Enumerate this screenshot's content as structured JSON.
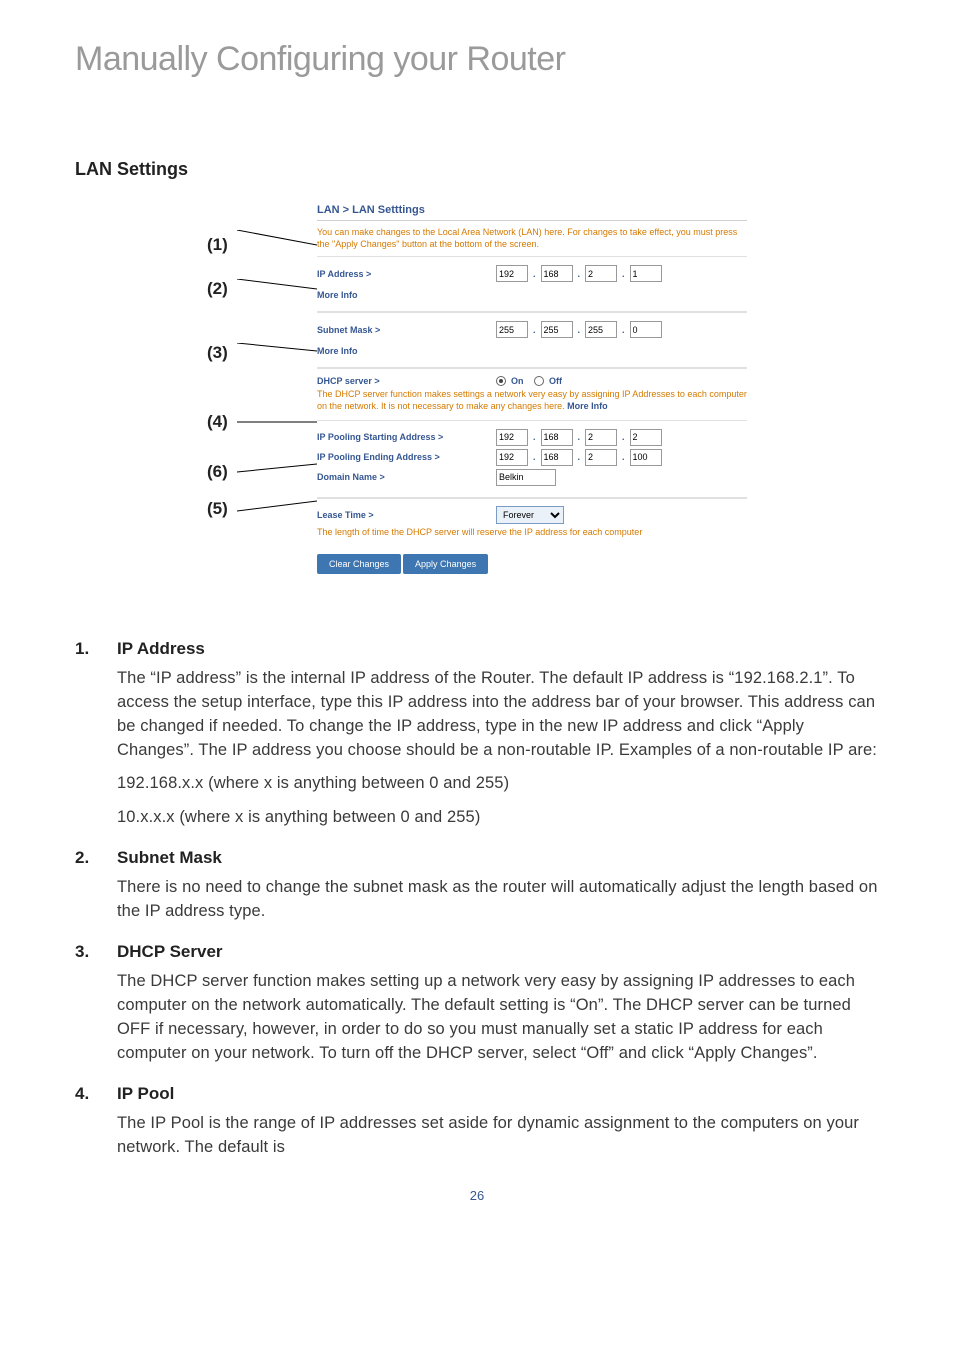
{
  "main_title": "Manually Configuring your Router",
  "lan": {
    "heading": "LAN Settings",
    "panel_header": "LAN > LAN Setttings",
    "panel_desc": "You can make changes to the Local Area Network (LAN) here. For changes to take effect, you must press the \"Apply Changes\" button at the bottom of the screen.",
    "ip_label": "IP Address >",
    "ip": [
      "192",
      "168",
      "2",
      "1"
    ],
    "more_info": "More Info",
    "sm_label": "Subnet Mask >",
    "sm": [
      "255",
      "255",
      "255",
      "0"
    ],
    "dhcp_label": "DHCP server >",
    "on": "On",
    "off": "Off",
    "dhcp_desc": "The DHCP server function makes settings a network very easy by assigning IP Addresses to each computer on the network. It is not necessary to make any changes here. ",
    "pool_start_label": "IP Pooling Starting Address >",
    "pool_start": [
      "192",
      "168",
      "2",
      "2"
    ],
    "pool_end_label": "IP Pooling Ending Address >",
    "pool_end": [
      "192",
      "168",
      "2",
      "100"
    ],
    "domain_label": "Domain Name >",
    "domain_val": "Belkin",
    "lease_label": "Lease Time >",
    "lease_val": "Forever",
    "lease_desc": "The length of time the DHCP server will reserve the IP address for each computer",
    "btn_clear": "Clear Changes",
    "btn_apply": "Apply Changes"
  },
  "callouts": [
    "(1)",
    "(2)",
    "(3)",
    "(4)",
    "(6)",
    "(5)"
  ],
  "items": [
    {
      "num": "1.",
      "title": "IP Address",
      "body": "The “IP address” is the internal IP address of the Router. The default IP address is “192.168.2.1”. To access the setup interface, type this IP address into the address bar of your browser. This address can be changed if needed. To change the IP address, type in the new IP address and click “Apply Changes”. The IP address you choose should be a non-routable IP. Examples of a non-routable IP are:",
      "examples": [
        "192.168.x.x (where x is anything between 0 and 255)",
        "10.x.x.x (where x is anything between 0 and 255)"
      ]
    },
    {
      "num": "2.",
      "title": "Subnet Mask",
      "body": "There is no need to change the subnet mask as the router will automatically adjust the length based on the IP address type."
    },
    {
      "num": "3.",
      "title": "DHCP Server",
      "body": "The DHCP server function makes setting up a network very easy by assigning IP addresses to each computer on the network automatically. The default setting is “On”. The DHCP server can be turned OFF if necessary, however, in order to do so you must manually set a static IP address for each computer on your network. To turn off the DHCP server, select “Off” and click “Apply Changes”."
    },
    {
      "num": "4.",
      "title": "IP Pool",
      "body": "The IP Pool is the range of IP addresses set aside for dynamic assignment to the computers on your network. The default is"
    }
  ],
  "page_num": "26"
}
